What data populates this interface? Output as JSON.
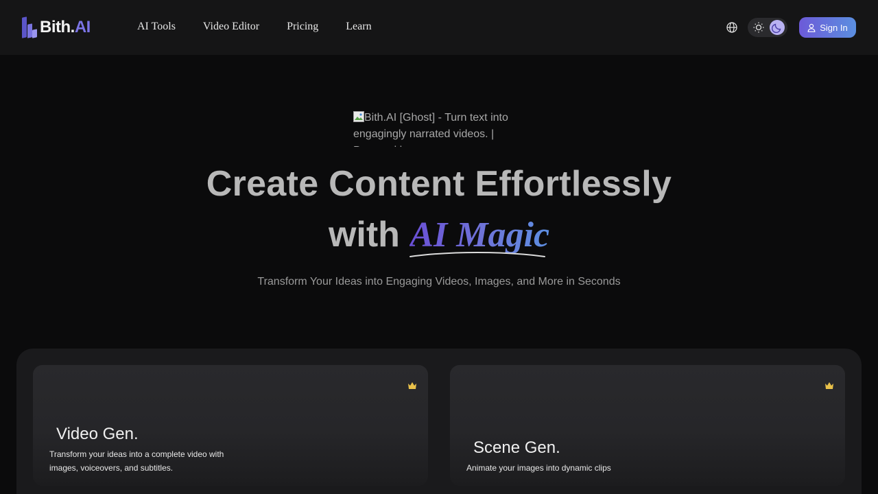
{
  "header": {
    "logo_main": "Bith",
    "logo_dot": ".",
    "logo_ai": "AI",
    "nav": [
      "AI Tools",
      "Video Editor",
      "Pricing",
      "Learn"
    ],
    "signin_label": "Sign In",
    "theme": "dark"
  },
  "hero": {
    "image_alt": "Bith.AI [Ghost] - Turn text into engagingly narrated videos. | Powered by",
    "title_line1": "Create Content Effortlessly",
    "title_with": "with",
    "title_magic": "AI Magic",
    "subtitle": "Transform Your Ideas into Engaging Videos, Images, and More in Seconds"
  },
  "cards": [
    {
      "title": "Video Gen.",
      "description": "Transform your ideas into a complete video with images, voiceovers, and subtitles.",
      "badge": "crown-icon"
    },
    {
      "title": "Scene Gen.",
      "description": "Animate your images into dynamic clips",
      "badge": "crown-icon"
    }
  ],
  "colors": {
    "accent": "#6c5ad8",
    "accent2": "#5b8fe0",
    "crown": "#e9c14a"
  }
}
